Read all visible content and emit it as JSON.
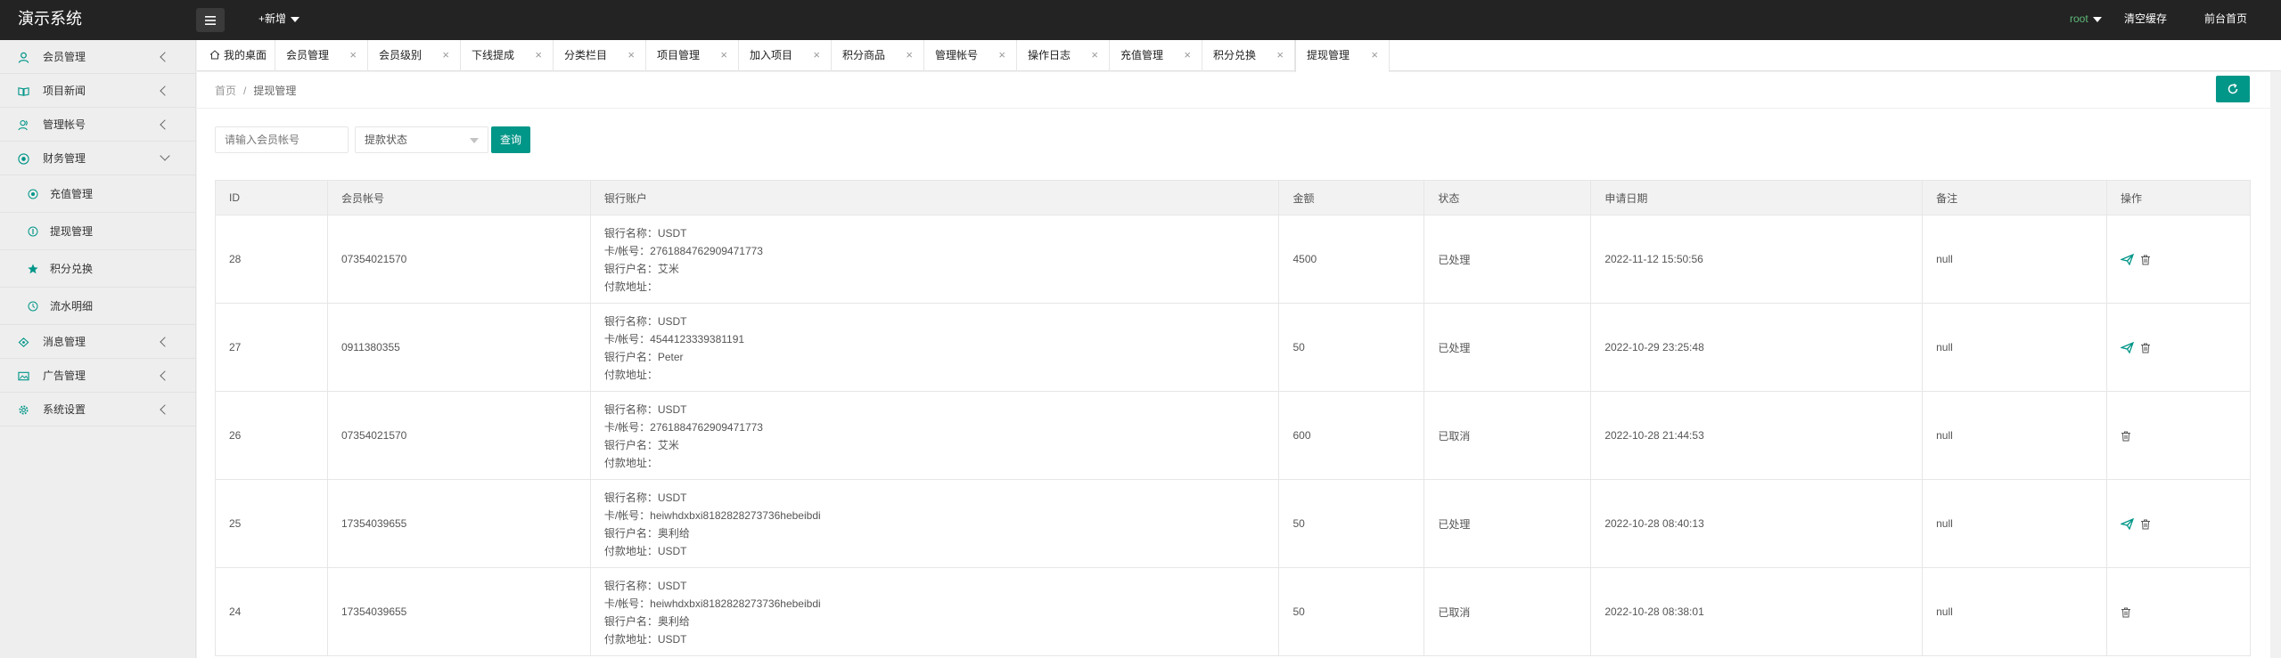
{
  "header": {
    "app_title": "演示系统",
    "add_new": "+新增",
    "user": "root",
    "clear_cache": "清空缓存",
    "front_home": "前台首页"
  },
  "sidebar": {
    "items": [
      {
        "label": "会员管理",
        "icon": "user-icon"
      },
      {
        "label": "项目新闻",
        "icon": "book-icon"
      },
      {
        "label": "管理帐号",
        "icon": "user-group-icon"
      },
      {
        "label": "财务管理",
        "icon": "finance-icon",
        "expanded": true
      },
      {
        "label": "消息管理",
        "icon": "message-icon"
      },
      {
        "label": "广告管理",
        "icon": "image-icon"
      },
      {
        "label": "系统设置",
        "icon": "gear-icon"
      }
    ],
    "sub_items": [
      {
        "label": "充值管理",
        "icon": "circle-dot-icon"
      },
      {
        "label": "提现管理",
        "icon": "circle-i-icon"
      },
      {
        "label": "积分兑换",
        "icon": "star-icon"
      },
      {
        "label": "流水明细",
        "icon": "clock-icon"
      }
    ]
  },
  "tabs": [
    {
      "label": "我的桌面",
      "icon": "home-icon"
    },
    {
      "label": "会员管理"
    },
    {
      "label": "会员级别"
    },
    {
      "label": "下线提成"
    },
    {
      "label": "分类栏目"
    },
    {
      "label": "项目管理"
    },
    {
      "label": "加入项目"
    },
    {
      "label": "积分商品"
    },
    {
      "label": "管理帐号"
    },
    {
      "label": "操作日志"
    },
    {
      "label": "充值管理"
    },
    {
      "label": "积分兑换"
    },
    {
      "label": "提现管理",
      "active": true
    }
  ],
  "tab_close": "×",
  "breadcrumb": {
    "home": "首页",
    "separator": "/",
    "current": "提现管理"
  },
  "search": {
    "placeholder": "请输入会员帐号",
    "status_placeholder": "提款状态",
    "query_button": "查询"
  },
  "table": {
    "columns": [
      "ID",
      "会员帐号",
      "银行账户",
      "金额",
      "状态",
      "申请日期",
      "备注",
      "操作"
    ],
    "bank_labels": {
      "name": "银行名称：",
      "card": "卡/帐号：",
      "holder": "银行户名：",
      "address": "付款地址："
    },
    "rows": [
      {
        "id": "28",
        "account": "07354021570",
        "bank_name": "USDT",
        "card": "2761884762909471773",
        "holder": "艾米",
        "address": "",
        "amount": "4500",
        "status": "已处理",
        "date": "2022-11-12 15:50:56",
        "remark": "null",
        "actions": [
          "send-icon",
          "trash-icon"
        ]
      },
      {
        "id": "27",
        "account": "0911380355",
        "bank_name": "USDT",
        "card": "4544123339381191",
        "holder": "Peter",
        "address": "",
        "amount": "50",
        "status": "已处理",
        "date": "2022-10-29 23:25:48",
        "remark": "null",
        "actions": [
          "send-icon",
          "trash-icon"
        ]
      },
      {
        "id": "26",
        "account": "07354021570",
        "bank_name": "USDT",
        "card": "2761884762909471773",
        "holder": "艾米",
        "address": "",
        "amount": "600",
        "status": "已取消",
        "date": "2022-10-28 21:44:53",
        "remark": "null",
        "actions": [
          "trash-icon"
        ]
      },
      {
        "id": "25",
        "account": "17354039655",
        "bank_name": "USDT",
        "card": "heiwhdxbxi8182828273736hebeibdi",
        "holder": "奥利给",
        "address": "USDT",
        "amount": "50",
        "status": "已处理",
        "date": "2022-10-28 08:40:13",
        "remark": "null",
        "actions": [
          "send-icon",
          "trash-icon"
        ]
      },
      {
        "id": "24",
        "account": "17354039655",
        "bank_name": "USDT",
        "card": "heiwhdxbxi8182828273736hebeibdi",
        "holder": "奥利给",
        "address": "USDT",
        "amount": "50",
        "status": "已取消",
        "date": "2022-10-28 08:38:01",
        "remark": "null",
        "actions": [
          "trash-icon"
        ]
      }
    ]
  },
  "colors": {
    "accent": "#009688",
    "header_bg": "#232323",
    "user_green": "#5fb878",
    "sidebar_icon": "#009688"
  }
}
